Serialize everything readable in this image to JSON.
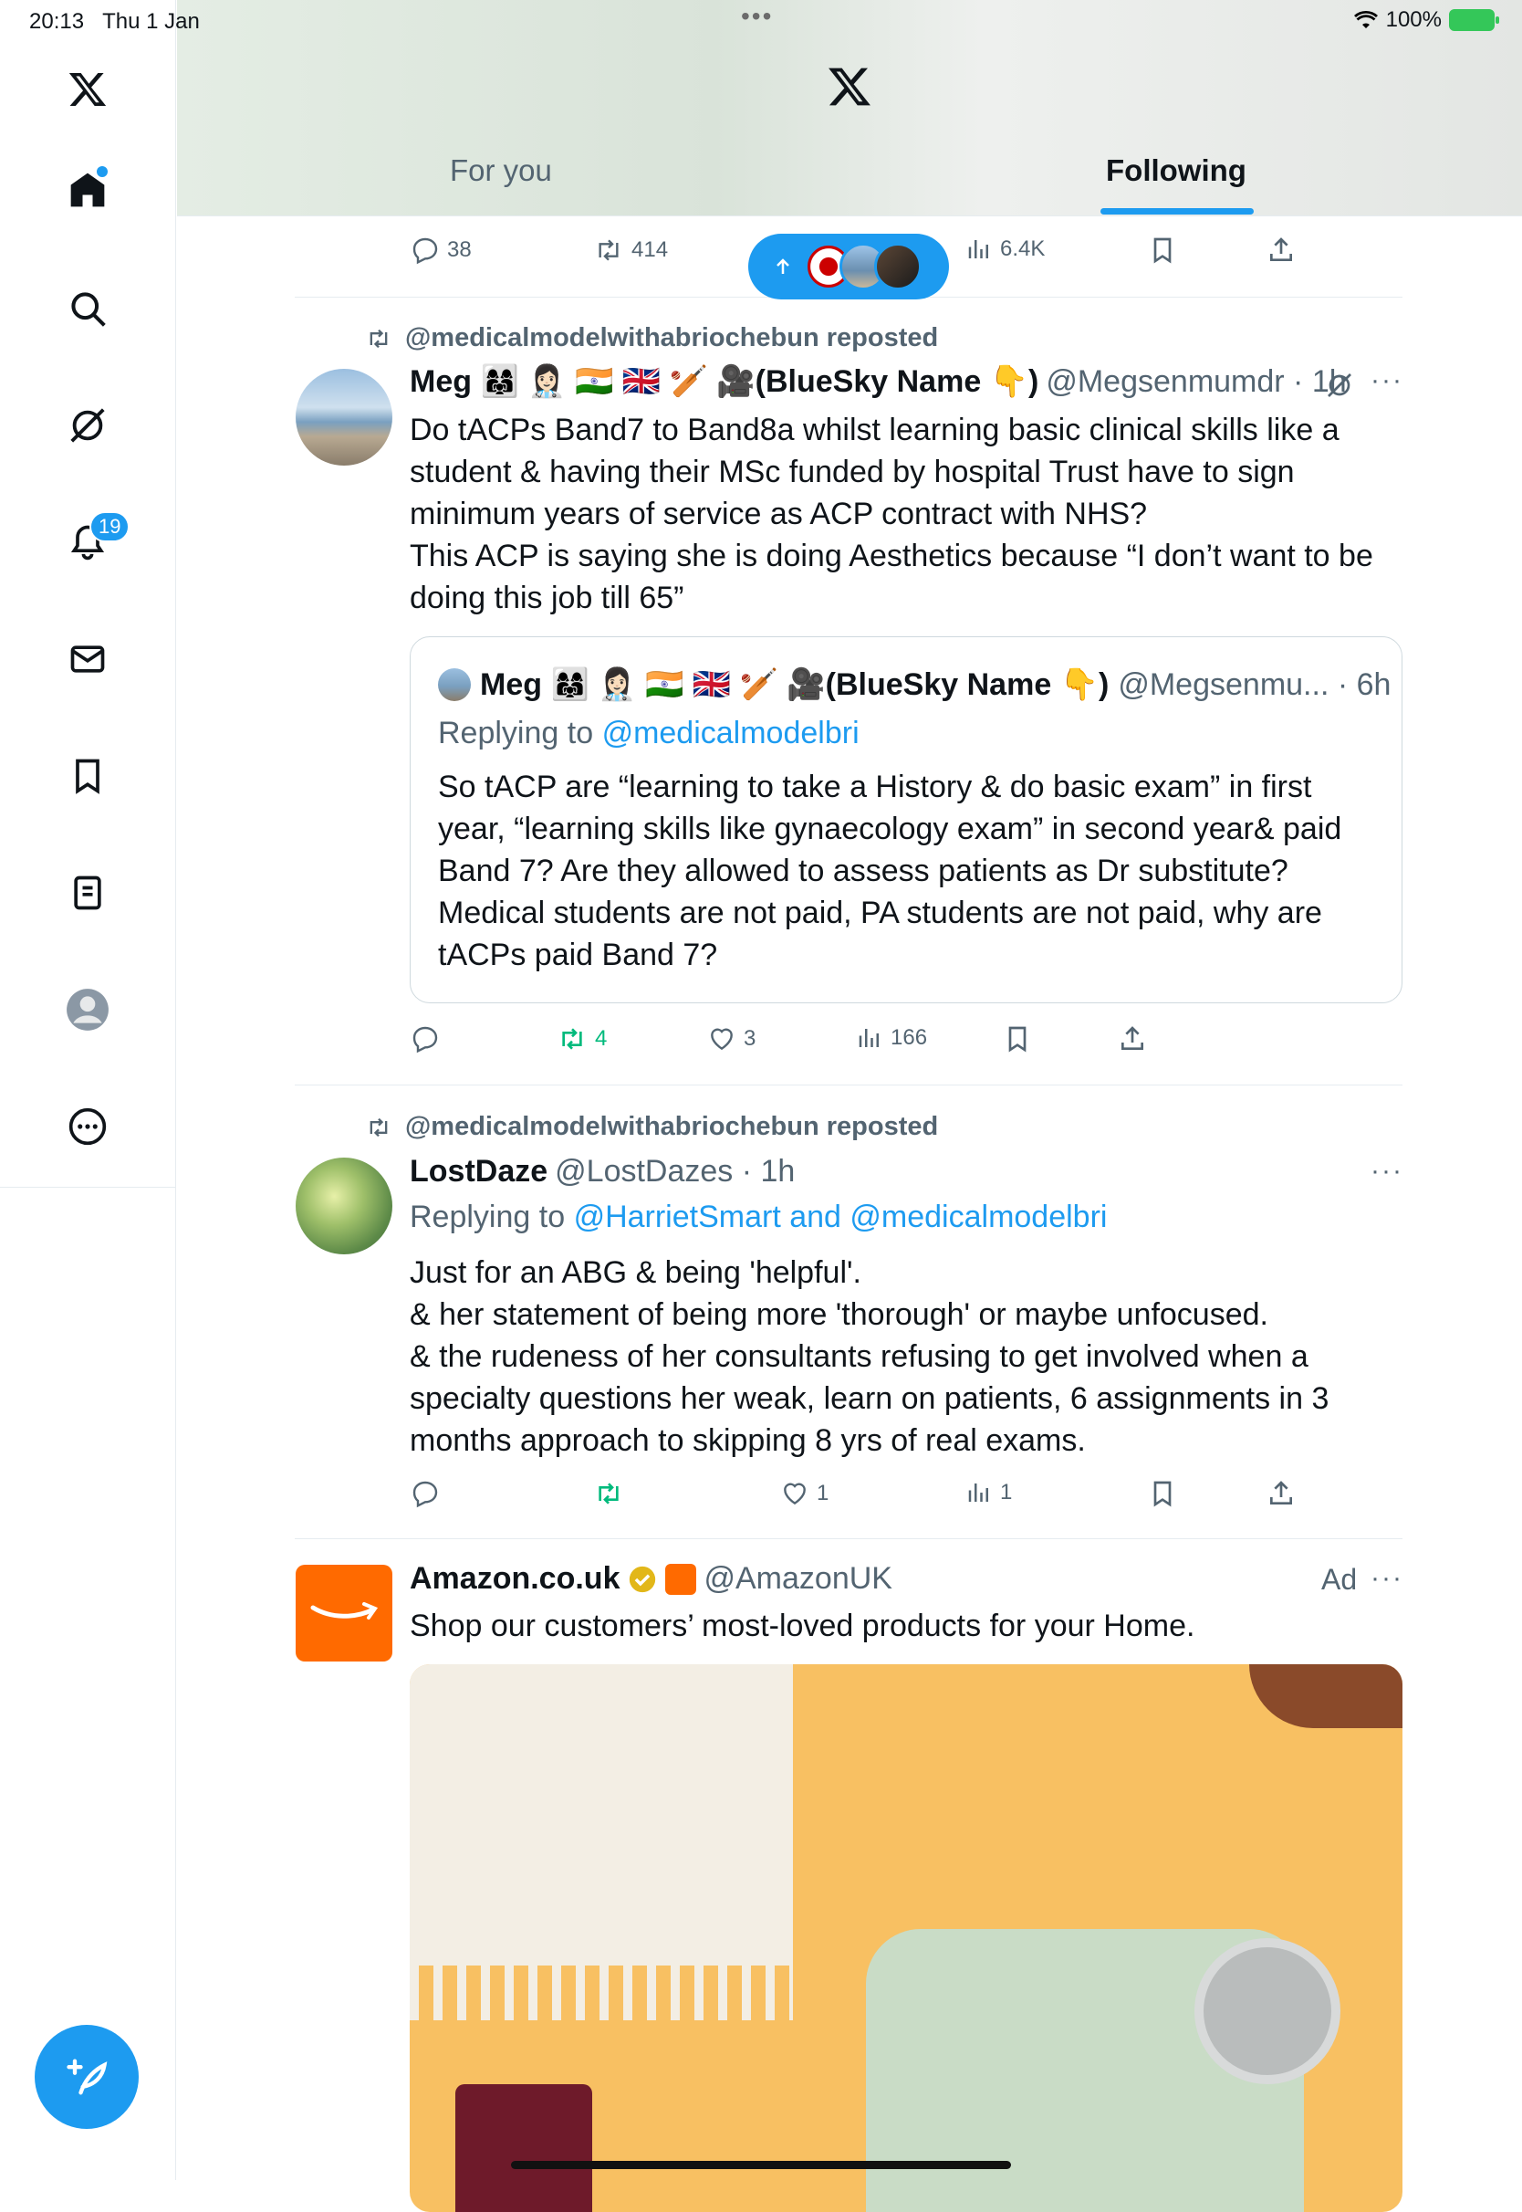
{
  "status": {
    "time": "20:13",
    "date": "Thu 1 Jan",
    "battery": "100%",
    "dots": "•••"
  },
  "sidebar": {
    "notifications_badge": "19"
  },
  "tabs": [
    {
      "label": "For you"
    },
    {
      "label": "Following"
    }
  ],
  "top_actions": {
    "replies": "38",
    "reposts": "414",
    "views": "6.4K"
  },
  "posts": [
    {
      "reposted_by": "@medicalmodelwithabriochebun reposted",
      "name": "Meg 👩‍👩‍👧 👩🏻‍⚕️ 🇮🇳 🇬🇧 🏏 🎥(BlueSky Name 👇)",
      "handle": "@Megsenmumdr · 1h",
      "text": [
        "Do tACPs Band7 to Band8a whilst learning basic clinical skills like a",
        "student & having their MSc funded by hospital Trust have to sign",
        "minimum years of service as ACP contract with NHS?",
        "This ACP is saying she is doing Aesthetics because “I don’t want to be",
        "doing this job till 65”"
      ],
      "quote": {
        "name": "Meg 👩‍👩‍👧 👩🏻‍⚕️ 🇮🇳 🇬🇧 🏏 🎥(BlueSky Name 👇)",
        "handle": "@Megsenmu... · 6h",
        "reply_prefix": "Replying to",
        "reply_to": "@medicalmodelbri",
        "text": [
          "So tACP are “learning to take a History & do basic exam” in first",
          "year, “learning skills like gynaecology exam” in second year& paid",
          "Band 7? Are they allowed to assess patients as Dr substitute?",
          "Medical students are not paid, PA students are not paid, why are",
          "tACPs paid Band 7?"
        ]
      },
      "reposts": "4",
      "likes": "3",
      "views": "166"
    },
    {
      "reposted_by": "@medicalmodelwithabriochebun reposted",
      "name": "LostDaze",
      "handle": "@LostDazes · 1h",
      "reply_prefix": "Replying to",
      "reply_to": "@HarrietSmart and @medicalmodelbri",
      "text": [
        "Just for an ABG & being 'helpful'.",
        "& her statement of being more 'thorough' or maybe unfocused.",
        "& the rudeness of her consultants refusing to get involved when a",
        "specialty questions her weak, learn on patients, 6 assignments in 3",
        "months approach to skipping 8 yrs of real exams."
      ],
      "likes": "1",
      "views": "1"
    },
    {
      "name": "Amazon.co.uk",
      "handle": "@AmazonUK",
      "ad_label": "Ad",
      "text": "Shop our customers’ most-loved products for your Home."
    }
  ]
}
